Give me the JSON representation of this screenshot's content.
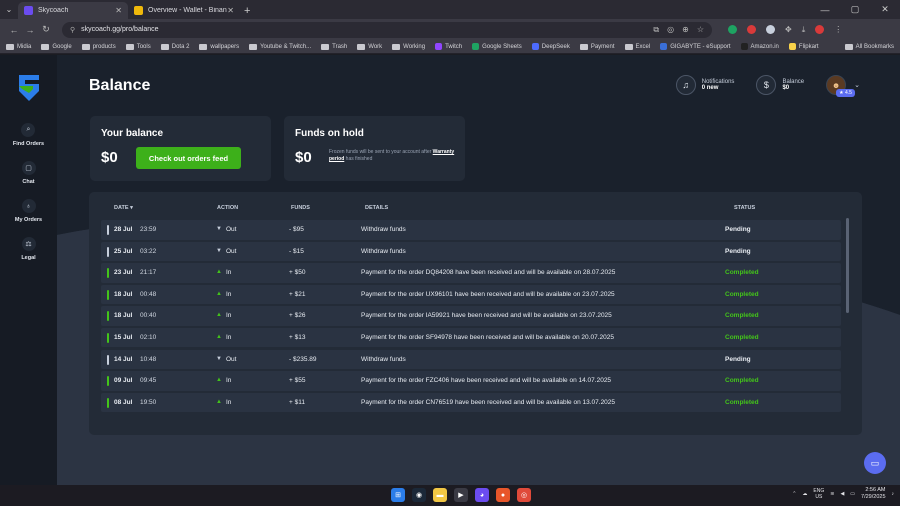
{
  "browser": {
    "tabs": [
      {
        "title": "Skycoach",
        "active": true,
        "favicon_color": "#6b4cf0"
      },
      {
        "title": "Overview - Wallet - Binance",
        "active": false,
        "favicon_color": "#f0b90b"
      }
    ],
    "new_tab": "+",
    "url": "skycoach.gg/pro/balance",
    "bookmarks": [
      {
        "label": "Midia",
        "type": "folder"
      },
      {
        "label": "Google",
        "type": "folder"
      },
      {
        "label": "products",
        "type": "folder"
      },
      {
        "label": "Tools",
        "type": "folder"
      },
      {
        "label": "Dota 2",
        "type": "folder"
      },
      {
        "label": "wallpapers",
        "type": "folder"
      },
      {
        "label": "Youtube & Twitch...",
        "type": "folder"
      },
      {
        "label": "Trash",
        "type": "folder"
      },
      {
        "label": "Work",
        "type": "folder"
      },
      {
        "label": "Working",
        "type": "folder"
      },
      {
        "label": "Twitch",
        "type": "site",
        "color": "#9146ff"
      },
      {
        "label": "Google Sheets",
        "type": "site",
        "color": "#1ea362"
      },
      {
        "label": "DeepSeek",
        "type": "site",
        "color": "#4d6bfe"
      },
      {
        "label": "Payment",
        "type": "folder"
      },
      {
        "label": "Excel",
        "type": "folder"
      },
      {
        "label": "GIGABYTE - eSupport",
        "type": "site",
        "color": "#3a6fd8"
      },
      {
        "label": "Amazon.in",
        "type": "site",
        "color": "#222222"
      },
      {
        "label": "Flipkart",
        "type": "site",
        "color": "#f8d24a"
      }
    ],
    "all_bookmarks": "All Bookmarks"
  },
  "sidebar": {
    "items": [
      {
        "label": "Find Orders",
        "icon": "search-icon",
        "glyph": "⌕"
      },
      {
        "label": "Chat",
        "icon": "chat-icon",
        "glyph": "▢"
      },
      {
        "label": "My Orders",
        "icon": "orders-icon",
        "glyph": "♁"
      },
      {
        "label": "Legal",
        "icon": "legal-icon",
        "glyph": "⚖"
      }
    ]
  },
  "header": {
    "title": "Balance",
    "notifications_label": "Notifications",
    "notifications_value": "0 new",
    "balance_label": "Balance",
    "balance_value": "$0",
    "rating": "★ 4.5"
  },
  "cards": {
    "your_balance_title": "Your balance",
    "your_balance_amount": "$0",
    "feed_button": "Check out orders feed",
    "on_hold_title": "Funds on hold",
    "on_hold_amount": "$0",
    "on_hold_note_pre": "Frozen funds will be sent to your account after",
    "on_hold_note_link": "Warranty period",
    "on_hold_note_post": "has finished"
  },
  "table": {
    "headers": {
      "date": "DATE ▾",
      "action": "ACTION",
      "funds": "FUNDS",
      "details": "DETAILS",
      "status": "STATUS"
    },
    "rows": [
      {
        "date": "28 Jul",
        "time": "23:59",
        "direction": "out",
        "action": "Out",
        "funds": "- $95",
        "details": "Withdraw funds",
        "status": "Pending"
      },
      {
        "date": "25 Jul",
        "time": "03:22",
        "direction": "out",
        "action": "Out",
        "funds": "- $15",
        "details": "Withdraw funds",
        "status": "Pending"
      },
      {
        "date": "23 Jul",
        "time": "21:17",
        "direction": "in",
        "action": "In",
        "funds": "+ $50",
        "details": "Payment for the order DQ84208 have been received and will be available on 28.07.2025",
        "status": "Completed"
      },
      {
        "date": "18 Jul",
        "time": "00:48",
        "direction": "in",
        "action": "In",
        "funds": "+ $21",
        "details": "Payment for the order UX96101 have been received and will be available on 23.07.2025",
        "status": "Completed"
      },
      {
        "date": "18 Jul",
        "time": "00:40",
        "direction": "in",
        "action": "In",
        "funds": "+ $26",
        "details": "Payment for the order IA59921 have been received and will be available on 23.07.2025",
        "status": "Completed"
      },
      {
        "date": "15 Jul",
        "time": "02:10",
        "direction": "in",
        "action": "In",
        "funds": "+ $13",
        "details": "Payment for the order SF94978 have been received and will be available on 20.07.2025",
        "status": "Completed"
      },
      {
        "date": "14 Jul",
        "time": "10:48",
        "direction": "out",
        "action": "Out",
        "funds": "- $235.89",
        "details": "Withdraw funds",
        "status": "Pending"
      },
      {
        "date": "09 Jul",
        "time": "09:45",
        "direction": "in",
        "action": "In",
        "funds": "+ $55",
        "details": "Payment for the order FZC406 have been received and will be available on 14.07.2025",
        "status": "Completed"
      },
      {
        "date": "08 Jul",
        "time": "19:50",
        "direction": "in",
        "action": "In",
        "funds": "+ $11",
        "details": "Payment for the order CN76519 have been received and will be available on 13.07.2025",
        "status": "Completed"
      }
    ]
  },
  "colors": {
    "pending_bar": "#c7cfdc",
    "completed": "#43c41a",
    "out_arrow": "#c7cfdc",
    "in_arrow": "#43c41a",
    "accent": "#5b6cf0"
  },
  "taskbar": {
    "lang_1": "ENG",
    "lang_2": "US",
    "time": "2:56 AM",
    "date": "7/29/2025"
  }
}
